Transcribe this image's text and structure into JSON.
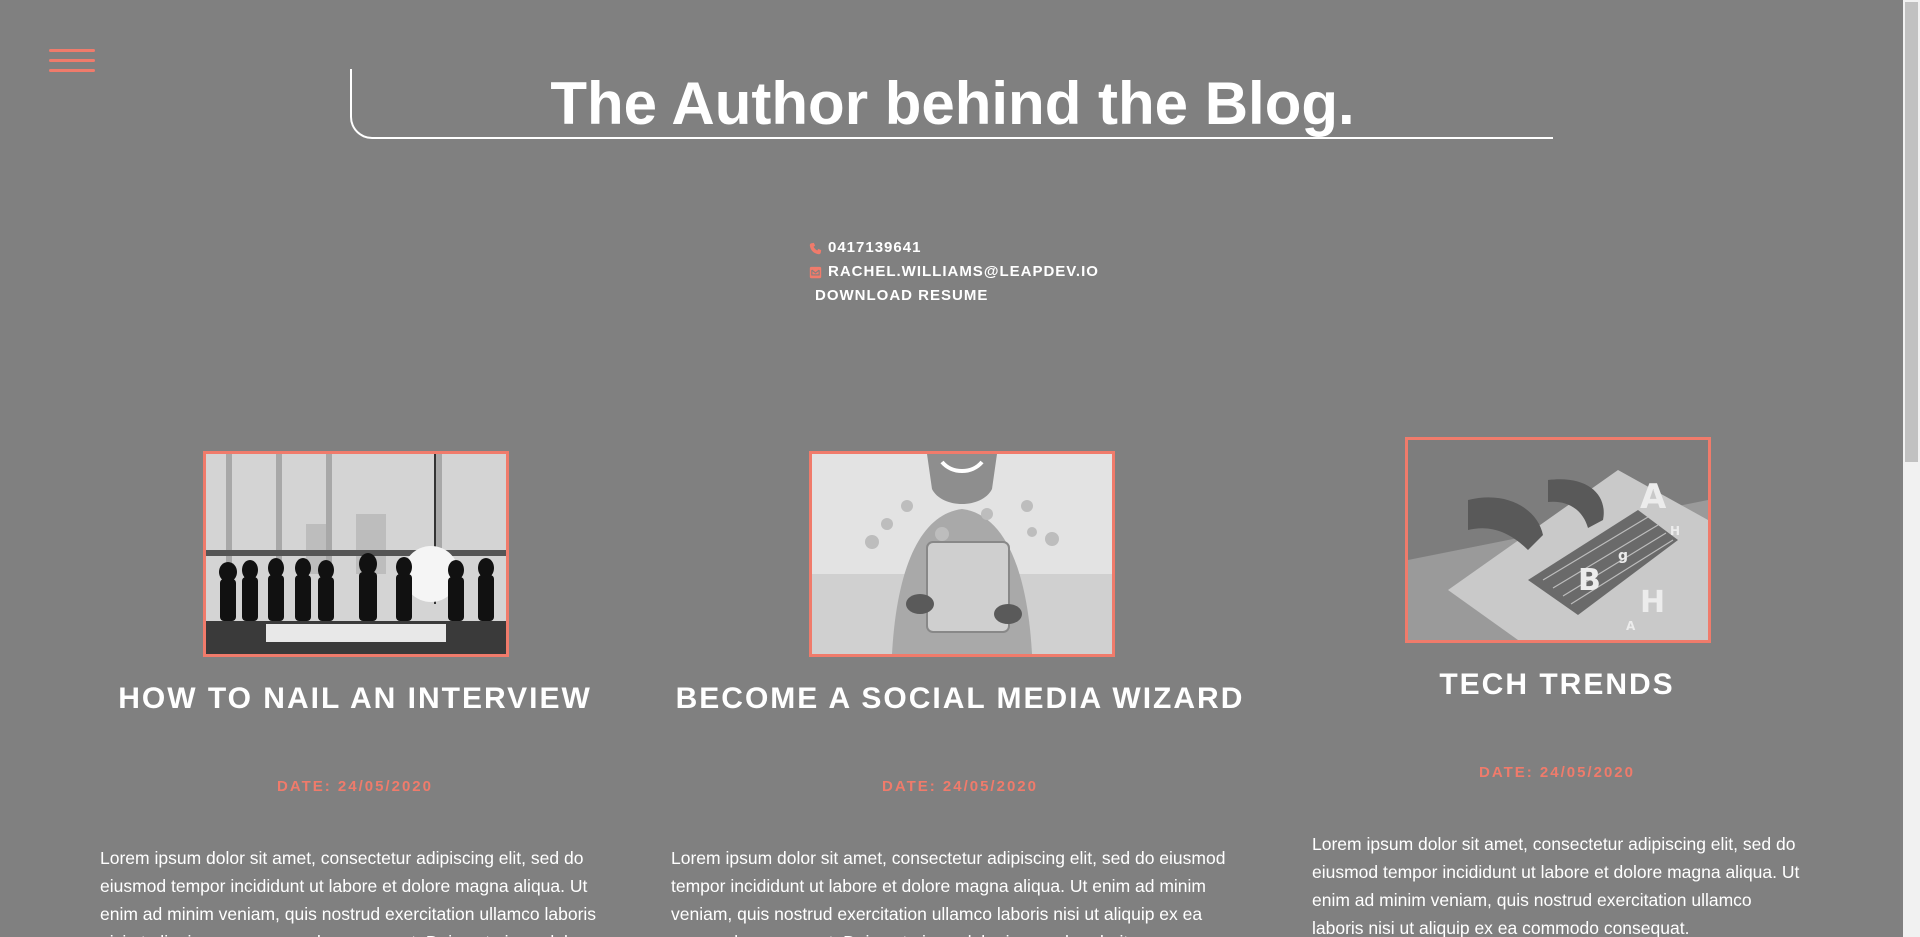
{
  "header": {
    "title": "The Author behind the Blog."
  },
  "contact": {
    "phone": "0417139641",
    "email": "RACHEL.WILLIAMS@LEAPDEV.IO",
    "download_label": "DOWNLOAD RESUME",
    "phone_icon": "phone-icon",
    "email_icon": "envelope-icon"
  },
  "nav": {
    "menu_icon": "hamburger-menu-icon"
  },
  "posts": [
    {
      "title": "HOW TO NAIL AN INTERVIEW",
      "date": "DATE: 24/05/2020",
      "body": "Lorem ipsum dolor sit amet, consectetur adipiscing elit, sed do eiusmod tempor incididunt ut labore et dolore magna aliqua. Ut enim ad minim veniam, quis nostrud exercitation ullamco laboris nisi ut aliquip ex ea commodo consequat. Duis aute irure dolor"
    },
    {
      "title": "BECOME A SOCIAL MEDIA WIZARD",
      "date": "DATE: 24/05/2020",
      "body": "Lorem ipsum dolor sit amet, consectetur adipiscing elit, sed do eiusmod tempor incididunt ut labore et dolore magna aliqua. Ut enim ad minim veniam, quis nostrud exercitation ullamco laboris nisi ut aliquip ex ea commodo consequat. Duis aute irure dolor in reprehenderit"
    },
    {
      "title": "TECH TRENDS",
      "date": "DATE: 24/05/2020",
      "body": "Lorem ipsum dolor sit amet, consectetur adipiscing elit, sed do eiusmod tempor incididunt ut labore et dolore magna aliqua. Ut enim ad minim veniam, quis nostrud exercitation ullamco laboris nisi ut aliquip ex ea commodo consequat."
    }
  ],
  "colors": {
    "background": "#808080",
    "accent": "#f07b6b",
    "text": "#ffffff"
  }
}
